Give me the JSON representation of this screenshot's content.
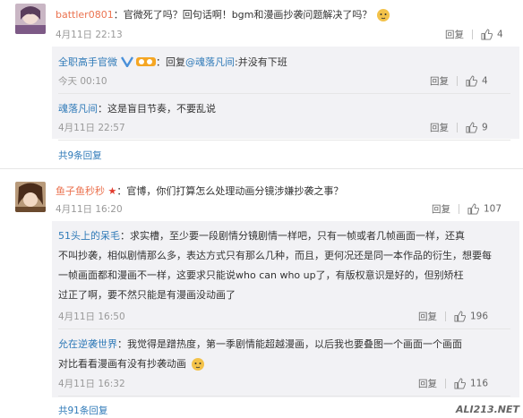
{
  "comments": [
    {
      "user": "battler0801",
      "text": "：官微死了吗？回句话啊！bgm和漫画抄袭问题解决了吗？",
      "time": "4月11日 22:13",
      "reply_label": "回复",
      "likes": "4",
      "replies": [
        {
          "user": "全职高手官微",
          "prefix": "：回复",
          "mention": "@魂落凡间",
          "text": ":并没有下班",
          "time": "今天 00:10",
          "reply_label": "回复",
          "likes": "4"
        },
        {
          "user": "魂落凡间",
          "text": "：这是盲目节奏，不要乱说",
          "time": "4月11日 22:57",
          "reply_label": "回复",
          "likes": "9"
        }
      ],
      "more": "共9条回复"
    },
    {
      "user": "鱼子鱼秒秒",
      "text": "：官博，你们打算怎么处理动画分镜涉嫌抄袭之事？",
      "time": "4月11日 16:20",
      "reply_label": "回复",
      "likes": "107",
      "replies": [
        {
          "user": "51头上的呆毛",
          "lines": [
            "：求实槽，至少要一段剧情分镜剧情一样吧，只有一帧或者几帧画面一样，还真",
            "不叫抄袭，相似剧情那么多，表达方式只有那么几种，而且，更何况还是同一本作品的衍生，想要每",
            "一帧画面都和漫画不一样，这要求只能说who can who up了，有版权意识是好的，但别矫枉",
            "过正了啊，要不然只能是有漫画没动画了"
          ],
          "time": "4月11日 16:50",
          "reply_label": "回复",
          "likes": "196"
        },
        {
          "user": "允在逆袭世界",
          "lines": [
            "：我觉得是蹭热度，第一季剧情能超越漫画，以后我也要叠图一个画面一个画面",
            "对比看看漫画有没有抄袭动画"
          ],
          "time": "4月11日 16:32",
          "reply_label": "回复",
          "likes": "116"
        }
      ],
      "more": "共91条回复"
    }
  ],
  "watermark": "ALI213.NET",
  "colors": {
    "orange_name": "#eb7350",
    "blue_name": "#2f7ab8",
    "reply_bg": "#f2f2f5"
  }
}
